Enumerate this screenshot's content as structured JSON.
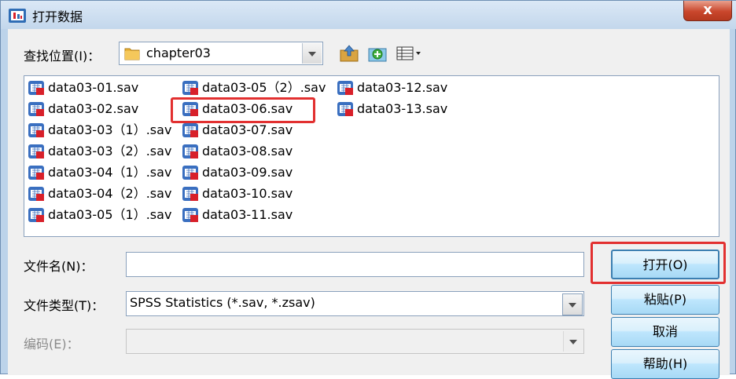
{
  "window": {
    "title": "打开数据",
    "close_label": "x"
  },
  "lookin": {
    "label": "查找位置(I)：",
    "value": "chapter03"
  },
  "toolbar": [
    "up-folder-icon",
    "new-folder-icon",
    "view-menu-icon"
  ],
  "files": [
    {
      "name": "data03-01.sav"
    },
    {
      "name": "data03-02.sav"
    },
    {
      "name": "data03-03（1）.sav"
    },
    {
      "name": "data03-03（2）.sav"
    },
    {
      "name": "data03-04（1）.sav"
    },
    {
      "name": "data03-04（2）.sav"
    },
    {
      "name": "data03-05（1）.sav"
    },
    {
      "name": "data03-05（2）.sav"
    },
    {
      "name": "data03-06.sav"
    },
    {
      "name": "data03-07.sav"
    },
    {
      "name": "data03-08.sav"
    },
    {
      "name": "data03-09.sav"
    },
    {
      "name": "data03-10.sav"
    },
    {
      "name": "data03-11.sav"
    },
    {
      "name": "data03-12.sav"
    },
    {
      "name": "data03-13.sav"
    }
  ],
  "form": {
    "filename_label": "文件名(N)：",
    "filename_value": "",
    "filetype_label": "文件类型(T)：",
    "filetype_value": "SPSS Statistics (*.sav, *.zsav)",
    "encoding_label": "编码(E)：",
    "encoding_value": ""
  },
  "buttons": {
    "open": "打开(O)",
    "paste": "粘贴(P)",
    "cancel": "取消",
    "help": "帮助(H)"
  },
  "colors": {
    "highlight": "#e23030",
    "button_border": "#3c7fb1",
    "file_icon_blue": "#3a6fc0",
    "file_icon_red": "#d8202a"
  }
}
